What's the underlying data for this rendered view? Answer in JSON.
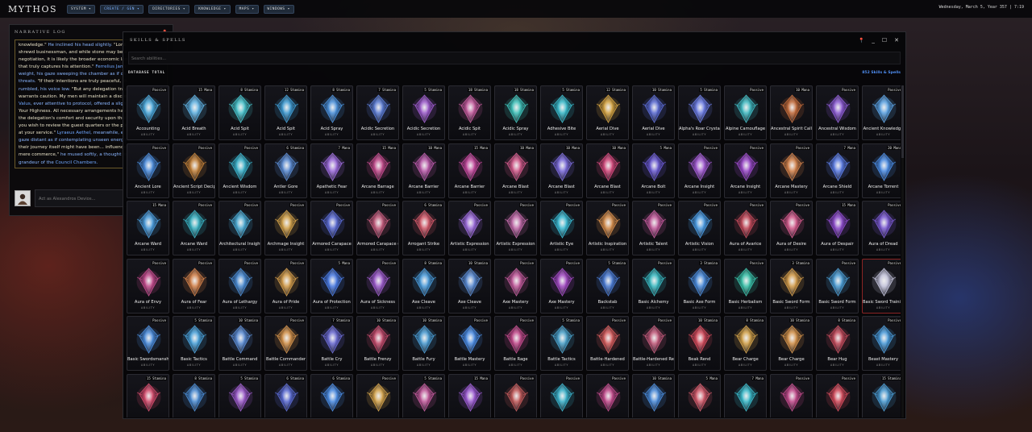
{
  "app": {
    "logo": "MYTHOS",
    "menu": [
      {
        "label": "SYSTEM ▾",
        "active": false
      },
      {
        "label": "CREATE / GEN ▾",
        "active": true
      },
      {
        "label": "DIRECTORIES ▾",
        "active": false
      },
      {
        "label": "KNOWLEDGE ▾",
        "active": false
      },
      {
        "label": "MAPS ▾",
        "active": false
      },
      {
        "label": "WINDOWS ▾",
        "active": false
      }
    ],
    "clock": "Wednesday, March 5, Year 357 | 7:19"
  },
  "log": {
    "title": "NARRATIVE LOG",
    "lines": [
      [
        {
          "t": "knowledge.\" ",
          "c": "speech"
        },
        {
          "t": "He inclined his head slightly. ",
          "c": "em"
        },
        {
          "t": "\"Lord",
          "c": "speech"
        }
      ],
      [
        {
          "t": "shrewd businessman, and while stone may be a",
          "c": "speech"
        }
      ],
      [
        {
          "t": "negotiation, it is likely the broader economic lan",
          "c": "speech"
        }
      ],
      [
        {
          "t": "that truly captures his attention.\" ",
          "c": "speech"
        },
        {
          "t": "Ferrelius Jann",
          "c": "name"
        }
      ],
      [
        {
          "t": "weight, his gaze sweeping the chamber as if ch",
          "c": "em"
        }
      ],
      [
        {
          "t": "threats. ",
          "c": "em"
        },
        {
          "t": "\"If their intentions are truly peaceful, th",
          "c": "speech"
        }
      ],
      [
        {
          "t": "rumbled, his voice low. ",
          "c": "em"
        },
        {
          "t": "\"But any delegation trav",
          "c": "speech"
        }
      ],
      [
        {
          "t": "warrants caution. My men will maintain a discre",
          "c": "speech"
        }
      ],
      [
        {
          "t": "Valus",
          "c": "name"
        },
        {
          "t": ", ever attentive to protocol, offered a sligh",
          "c": "em"
        }
      ],
      [
        {
          "t": "Your Highness. All necessary arrangements hav",
          "c": "speech"
        }
      ],
      [
        {
          "t": "the delegation's comfort and security upon their",
          "c": "speech"
        }
      ],
      [
        {
          "t": "you wish to review the guest quarters or the pla",
          "c": "speech"
        }
      ],
      [
        {
          "t": "at your service.\" ",
          "c": "speech"
        },
        {
          "t": "Lyraeus Aethel",
          "c": "name"
        },
        {
          "t": ", meanwhile, e",
          "c": "em"
        }
      ],
      [
        {
          "t": "gaze distant as if contemplating unseen energie",
          "c": "em"
        }
      ],
      [
        {
          "t": "their journey itself might have been... influence",
          "c": "speech"
        }
      ],
      [
        {
          "t": "mere commerce,\" ",
          "c": "speech"
        },
        {
          "t": "he mused softly, a thought lo",
          "c": "em"
        }
      ],
      [
        {
          "t": "grandeur of the ",
          "c": "em"
        },
        {
          "t": "Council Chambers",
          "c": "name"
        },
        {
          "t": ".",
          "c": "em"
        }
      ]
    ],
    "input_placeholder": "Act as Alexandros Devios..."
  },
  "skills": {
    "title": "SKILLS & SPELLS",
    "search_placeholder": "Search abilities...",
    "db_label": "DATABASE TOTAL",
    "db_count": "852 Skills & Spells",
    "type_label": "ABILITY",
    "cards": [
      {
        "name": "Accounting",
        "cost": "Passive",
        "hue": "#4aa6d8"
      },
      {
        "name": "Acid Breath",
        "cost": "15 Mana",
        "hue": "#5fb0e0"
      },
      {
        "name": "Acid Spit",
        "cost": "8 Stamina",
        "hue": "#46c0c8"
      },
      {
        "name": "Acid Spit",
        "cost": "12 Stamina",
        "hue": "#3f9ad0"
      },
      {
        "name": "Acid Spray",
        "cost": "8 Stamina",
        "hue": "#4a8fd8"
      },
      {
        "name": "Acidic Secretion",
        "cost": "7 Stamina",
        "hue": "#5a7ad0"
      },
      {
        "name": "Acidic Secretion",
        "cost": "5 Stamina",
        "hue": "#9a5ac8"
      },
      {
        "name": "Acidic Spit",
        "cost": "18 Stamina",
        "hue": "#c05a9a"
      },
      {
        "name": "Acidic Spray",
        "cost": "18 Stamina",
        "hue": "#3fc0b8"
      },
      {
        "name": "Adhesive Bite",
        "cost": "5 Stamina",
        "hue": "#38b8c8"
      },
      {
        "name": "Aerial Dive",
        "cost": "12 Stamina",
        "hue": "#d0a040"
      },
      {
        "name": "Aerial Dive",
        "cost": "10 Stamina",
        "hue": "#5a6ad0"
      },
      {
        "name": "Alpha's Roar Crystal",
        "cost": "5 Stamina",
        "hue": "#6a7ae0"
      },
      {
        "name": "Alpine Camouflage",
        "cost": "Passive",
        "hue": "#40b8c0"
      },
      {
        "name": "Ancestral Spirit Calling",
        "cost": "10 Mana",
        "hue": "#c06a3a"
      },
      {
        "name": "Ancestral Wisdom",
        "cost": "Passive",
        "hue": "#8a5ad0"
      },
      {
        "name": "Ancient Knowledge",
        "cost": "Passive",
        "hue": "#5aa0e0"
      },
      {
        "name": "Ancient Lore",
        "cost": "Passive",
        "hue": "#4a8ad8"
      },
      {
        "name": "Ancient Script Deciphering",
        "cost": "Passive",
        "hue": "#c0803a"
      },
      {
        "name": "Ancient Wisdom",
        "cost": "Passive",
        "hue": "#3ab0c8"
      },
      {
        "name": "Antler Gore",
        "cost": "6 Stamina",
        "hue": "#5a8ad0"
      },
      {
        "name": "Apathetic Fear",
        "cost": "7 Mana",
        "hue": "#9a6ad8"
      },
      {
        "name": "Arcane Barrage",
        "cost": "15 Mana",
        "hue": "#c04a8a"
      },
      {
        "name": "Arcane Barrier",
        "cost": "10 Mana",
        "hue": "#b85aa8"
      },
      {
        "name": "Arcane Barrier",
        "cost": "15 Mana",
        "hue": "#c0489a"
      },
      {
        "name": "Arcane Blast",
        "cost": "10 Mana",
        "hue": "#d05a8a"
      },
      {
        "name": "Arcane Blast",
        "cost": "10 Mana",
        "hue": "#7a6ad8"
      },
      {
        "name": "Arcane Blast",
        "cost": "10 Mana",
        "hue": "#d0487a"
      },
      {
        "name": "Arcane Bolt",
        "cost": "5 Mana",
        "hue": "#6a5ad0"
      },
      {
        "name": "Arcane Insight",
        "cost": "Passive",
        "hue": "#a05ad0"
      },
      {
        "name": "Arcane Insight",
        "cost": "Passive",
        "hue": "#9a4ac8"
      },
      {
        "name": "Arcane Mastery",
        "cost": "Passive",
        "hue": "#d0804a"
      },
      {
        "name": "Arcane Shield",
        "cost": "7 Mana",
        "hue": "#5a7ae0"
      },
      {
        "name": "Arcane Torrent",
        "cost": "20 Mana",
        "hue": "#4a8ae0"
      },
      {
        "name": "Arcane Ward",
        "cost": "15 Mana",
        "hue": "#4a9ad8"
      },
      {
        "name": "Arcane Ward",
        "cost": "Passive",
        "hue": "#3ab0c0"
      },
      {
        "name": "Architectural Insight",
        "cost": "Passive",
        "hue": "#4aa8d0"
      },
      {
        "name": "Archmage Insight",
        "cost": "Passive",
        "hue": "#d0a04a"
      },
      {
        "name": "Armored Carapace",
        "cost": "Passive",
        "hue": "#5a6ad0"
      },
      {
        "name": "Armored Carapace (Kinetic)",
        "cost": "Passive",
        "hue": "#c05a7a"
      },
      {
        "name": "Arrogant Strike",
        "cost": "6 Stamina",
        "hue": "#d05a6a"
      },
      {
        "name": "Artistic Expression",
        "cost": "Passive",
        "hue": "#9a6ad8"
      },
      {
        "name": "Artistic Expression",
        "cost": "Passive",
        "hue": "#c06aa8"
      },
      {
        "name": "Artistic Eye",
        "cost": "Passive",
        "hue": "#3ab8d0"
      },
      {
        "name": "Artistic Inspiration",
        "cost": "Passive",
        "hue": "#d08a4a"
      },
      {
        "name": "Artistic Talent",
        "cost": "Passive",
        "hue": "#c05a9a"
      },
      {
        "name": "Artistic Vision",
        "cost": "Passive",
        "hue": "#4a9ae0"
      },
      {
        "name": "Aura of Avarice",
        "cost": "Passive",
        "hue": "#c04a5a"
      },
      {
        "name": "Aura of Desire",
        "cost": "Passive",
        "hue": "#d05a8a"
      },
      {
        "name": "Aura of Despair",
        "cost": "15 Mana",
        "hue": "#8a4ac8"
      },
      {
        "name": "Aura of Dread",
        "cost": "Passive",
        "hue": "#7a5ad0"
      },
      {
        "name": "Aura of Envy",
        "cost": "Passive",
        "hue": "#c04a8a"
      },
      {
        "name": "Aura of Fear",
        "cost": "Passive",
        "hue": "#d0804a"
      },
      {
        "name": "Aura of Lethargy",
        "cost": "Passive",
        "hue": "#4a8ad0"
      },
      {
        "name": "Aura of Pride",
        "cost": "Passive",
        "hue": "#d09a4a"
      },
      {
        "name": "Aura of Protection",
        "cost": "5 Mana",
        "hue": "#4a7ae0"
      },
      {
        "name": "Aura of Sickness",
        "cost": "Passive",
        "hue": "#9a5ac8"
      },
      {
        "name": "Axe Cleave",
        "cost": "8 Stamina",
        "hue": "#4a9ad8"
      },
      {
        "name": "Axe Cleave",
        "cost": "10 Stamina",
        "hue": "#5a8ad0"
      },
      {
        "name": "Axe Mastery",
        "cost": "Passive",
        "hue": "#c05a9a"
      },
      {
        "name": "Axe Mastery",
        "cost": "Passive",
        "hue": "#a04ac0"
      },
      {
        "name": "Backstab",
        "cost": "5 Stamina",
        "hue": "#4a7ad0"
      },
      {
        "name": "Basic Alchemy",
        "cost": "Passive",
        "hue": "#3ab8c0"
      },
      {
        "name": "Basic Axe Form",
        "cost": "3 Stamina",
        "hue": "#4a8ad8"
      },
      {
        "name": "Basic Herbalism",
        "cost": "Passive",
        "hue": "#3ac0a8"
      },
      {
        "name": "Basic Sword Form",
        "cost": "3 Stamina",
        "hue": "#d09a4a"
      },
      {
        "name": "Basic Sword Form",
        "cost": "Passive",
        "hue": "#4a9ad0"
      },
      {
        "name": "Basic Sword Training",
        "cost": "Passive",
        "hue": "#c0c0d8",
        "highlight": true
      },
      {
        "name": "Basic Swordsmanship",
        "cost": "Passive",
        "hue": "#4a8ad8"
      },
      {
        "name": "Basic Tactics",
        "cost": "5 Stamina",
        "hue": "#4aa0d8"
      },
      {
        "name": "Battle Command",
        "cost": "10 Stamina",
        "hue": "#5a8ad0"
      },
      {
        "name": "Battle Commander",
        "cost": "Passive",
        "hue": "#d0904a"
      },
      {
        "name": "Battle Cry",
        "cost": "7 Stamina",
        "hue": "#6a6ad0"
      },
      {
        "name": "Battle Frenzy",
        "cost": "10 Stamina",
        "hue": "#c04a6a"
      },
      {
        "name": "Battle Fury",
        "cost": "10 Stamina",
        "hue": "#4a9ad0"
      },
      {
        "name": "Battle Mastery",
        "cost": "Passive",
        "hue": "#4a8ae0"
      },
      {
        "name": "Battle Rage",
        "cost": "Passive",
        "hue": "#c04a8a"
      },
      {
        "name": "Battle Tactics",
        "cost": "5 Stamina",
        "hue": "#4aa0c8"
      },
      {
        "name": "Battle-Hardened",
        "cost": "Passive",
        "hue": "#d05a5a"
      },
      {
        "name": "Battle-Hardened Resolve",
        "cost": "Passive",
        "hue": "#c05a7a"
      },
      {
        "name": "Beak Rend",
        "cost": "10 Stamina",
        "hue": "#d04a5a"
      },
      {
        "name": "Bear Charge",
        "cost": "8 Stamina",
        "hue": "#d0a04a"
      },
      {
        "name": "Bear Charge",
        "cost": "10 Stamina",
        "hue": "#d0904a"
      },
      {
        "name": "Bear Hug",
        "cost": "8 Stamina",
        "hue": "#c04a5a"
      },
      {
        "name": "Beast Mastery",
        "cost": "Passive",
        "hue": "#4a9ad8"
      },
      {
        "name": "",
        "cost": "15 Stamina",
        "hue": "#d04a6a"
      },
      {
        "name": "",
        "cost": "8 Stamina",
        "hue": "#4a8ad0"
      },
      {
        "name": "",
        "cost": "5 Stamina",
        "hue": "#9a5ac8"
      },
      {
        "name": "",
        "cost": "6 Stamina",
        "hue": "#5a6ad0"
      },
      {
        "name": "",
        "cost": "6 Stamina",
        "hue": "#4a8ae0"
      },
      {
        "name": "",
        "cost": "Passive",
        "hue": "#d0a04a"
      },
      {
        "name": "",
        "cost": "5 Stamina",
        "hue": "#c05a9a"
      },
      {
        "name": "",
        "cost": "15 Mana",
        "hue": "#9a5ad0"
      },
      {
        "name": "",
        "cost": "Passive",
        "hue": "#c05a5a"
      },
      {
        "name": "",
        "cost": "Passive",
        "hue": "#3ab0c8"
      },
      {
        "name": "",
        "cost": "Passive",
        "hue": "#c04a8a"
      },
      {
        "name": "",
        "cost": "10 Stamina",
        "hue": "#4a8ad8"
      },
      {
        "name": "",
        "cost": "5 Mana",
        "hue": "#d05a6a"
      },
      {
        "name": "",
        "cost": "7 Mana",
        "hue": "#3ab8c8"
      },
      {
        "name": "",
        "cost": "Passive",
        "hue": "#c04a8a"
      },
      {
        "name": "",
        "cost": "Passive",
        "hue": "#d04a5a"
      },
      {
        "name": "",
        "cost": "15 Stamina",
        "hue": "#4a9ad0"
      }
    ]
  }
}
